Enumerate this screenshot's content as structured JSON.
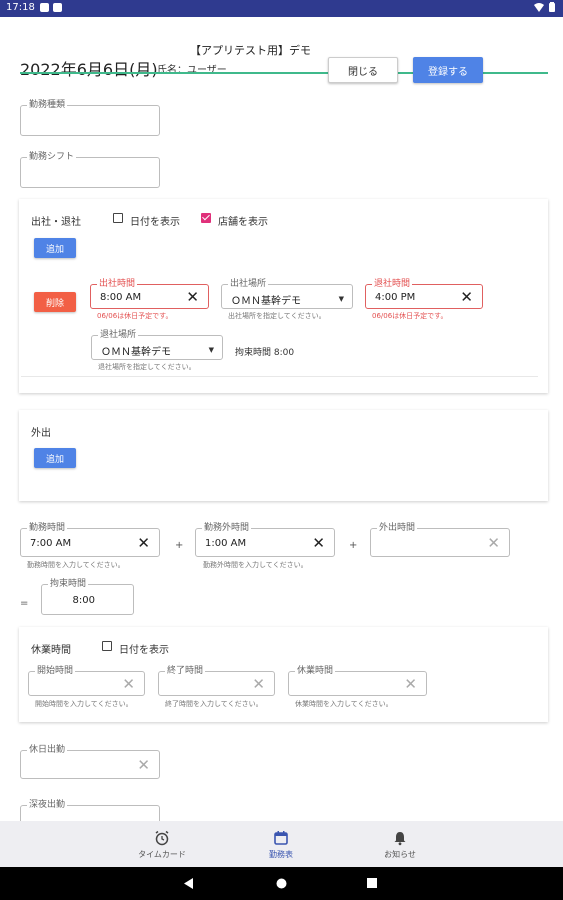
{
  "status_bar": {
    "time": "17:18",
    "app_icons": [
      "app-icon-g",
      "app-icon-doc"
    ],
    "right_icons": [
      "wifi-icon",
      "battery-icon"
    ]
  },
  "header": {
    "demo_title": "【アプリテスト用】デモ",
    "date": "2022年6月6日(月)",
    "user": "氏名：ユーザー",
    "close_label": "閉じる",
    "register_label": "登録する"
  },
  "work_type": {
    "label": "勤務種類",
    "value": ""
  },
  "work_shift": {
    "label": "勤務シフト",
    "value": ""
  },
  "attendance": {
    "title": "出社・退社",
    "show_date_label": "日付を表示",
    "show_date_checked": false,
    "show_store_label": "店舗を表示",
    "show_store_checked": true,
    "add_label": "追加",
    "entry": {
      "delete_label": "削除",
      "checkin_time": {
        "label": "出社時間",
        "value": "8:00 AM",
        "helper": "06/06は休日予定です。"
      },
      "checkin_place": {
        "label": "出社場所",
        "value": "ＯＭＮ基幹デモ",
        "helper": "出社場所を指定してください。"
      },
      "checkout_time": {
        "label": "退社時間",
        "value": "4:00 PM",
        "helper": "06/06は休日予定です。"
      },
      "checkout_place": {
        "label": "退社場所",
        "value": "ＯＭＮ基幹デモ",
        "helper": "退社場所を指定してください。"
      },
      "bound_time": "拘束時間 8:00"
    }
  },
  "outing": {
    "title": "外出",
    "add_label": "追加"
  },
  "totals": {
    "work_time": {
      "label": "勤務時間",
      "value": "7:00 AM",
      "helper": "勤務時間を入力してください。"
    },
    "plus1": "+",
    "non_work_time": {
      "label": "勤務外時間",
      "value": "1:00 AM",
      "helper": "勤務外時間を入力してください。"
    },
    "plus2": "+",
    "outing_time": {
      "label": "外出時間",
      "value": ""
    },
    "equals": "=",
    "bound_time": {
      "label": "拘束時間",
      "value": "8:00"
    }
  },
  "break": {
    "title": "休業時間",
    "show_date_label": "日付を表示",
    "show_date_checked": false,
    "start": {
      "label": "開始時間",
      "value": "",
      "helper": "開始時間を入力してください。"
    },
    "end": {
      "label": "終了時間",
      "value": "",
      "helper": "終了時間を入力してください。"
    },
    "duration": {
      "label": "休業時間",
      "value": "",
      "helper": "休業時間を入力してください。"
    }
  },
  "holiday_work": {
    "label": "休日出勤",
    "value": ""
  },
  "partial_field_label": "深夜出勤",
  "bottom_nav": [
    {
      "label": "タイムカード",
      "icon": "alarm-clock-icon",
      "active": false
    },
    {
      "label": "勤務表",
      "icon": "calendar-icon",
      "active": true
    },
    {
      "label": "お知らせ",
      "icon": "bell-icon",
      "active": false
    }
  ],
  "colors": {
    "accent_blue": "#4f83e6",
    "delete_red": "#f25f45",
    "status_bar": "#2f3a8f",
    "green_line": "#3fb98b",
    "checkbox_pink": "#e0307a"
  }
}
